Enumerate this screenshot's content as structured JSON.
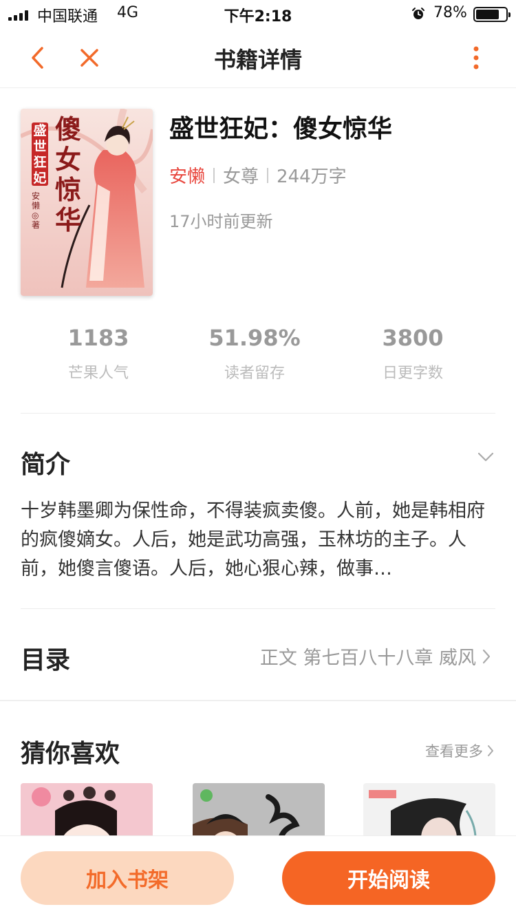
{
  "status_bar": {
    "carrier": "中国联通",
    "network": "4G",
    "time": "下午2:18",
    "battery": "78%",
    "battery_level": 0.78
  },
  "nav": {
    "title": "书籍详情",
    "icons": [
      "back-chevron-icon",
      "close-icon",
      "more-vertical-icon"
    ],
    "accent_color": "#f26a2a"
  },
  "book": {
    "title": "盛世狂妃：傻女惊华",
    "author": "安懒",
    "category": "女尊",
    "word_count": "244万字",
    "update": "17小时前更新",
    "cover_text": {
      "series": "盛世狂妃",
      "main": "傻女惊华",
      "author_mark": "安懒◎著"
    }
  },
  "stats": [
    {
      "value": "1183",
      "label": "芒果人气"
    },
    {
      "value": "51.98%",
      "label": "读者留存"
    },
    {
      "value": "3800",
      "label": "日更字数"
    }
  ],
  "intro": {
    "heading": "简介",
    "text": "十岁韩墨卿为保性命，不得装疯卖傻。人前，她是韩相府的疯傻嫡女。人后，她是武功高强，玉林坊的主子。人前，她傻言傻语。人后，她心狠心辣，做事…"
  },
  "toc": {
    "heading": "目录",
    "latest": "正文 第七百八十八章 威风"
  },
  "recommend": {
    "heading": "猜你喜欢",
    "more": "查看更多"
  },
  "actions": {
    "add_shelf": "加入书架",
    "start_read": "开始阅读"
  }
}
